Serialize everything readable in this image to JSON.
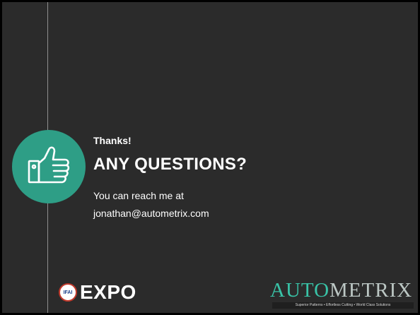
{
  "slide": {
    "thanks": "Thanks!",
    "title": "ANY QUESTIONS?",
    "contact_line1": "You can reach me at",
    "contact_line2": "jonathan@autometrix.com"
  },
  "logos": {
    "ifai_badge": "IFAI",
    "expo": "EXPO",
    "autometrix_auto": "AUTO",
    "autometrix_metrix": "METRIX",
    "autometrix_tagline": "Superior Patterns  •  Effortless Cutting  •  World Class Solutions"
  },
  "colors": {
    "background": "#2b2b2b",
    "accent_teal": "#2e9e86",
    "text": "#ffffff"
  },
  "icons": {
    "thumb": "thumbs-up-icon"
  }
}
